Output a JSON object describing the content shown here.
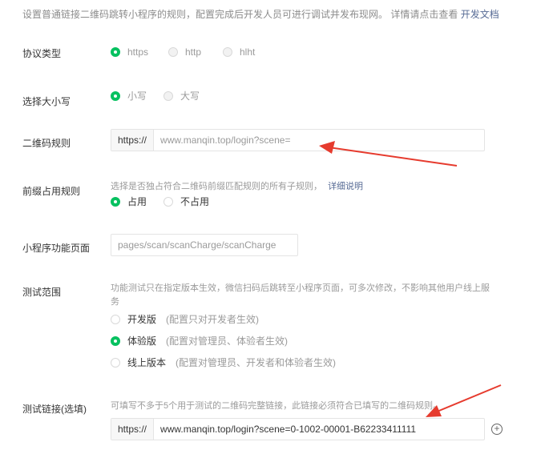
{
  "intro": {
    "text": "设置普通链接二维码跳转小程序的规则，配置完成后开发人员可进行调试并发布现网。 详情请点击查看",
    "link": "开发文档"
  },
  "protocol": {
    "label": "协议类型",
    "options": [
      "https",
      "http",
      "hlht"
    ],
    "selected": "https"
  },
  "case": {
    "label": "选择大小写",
    "options": [
      "小写",
      "大写"
    ],
    "selected": "小写"
  },
  "qr_rule": {
    "label": "二维码规则",
    "prefix": "https://",
    "value": "www.manqin.top/login?scene="
  },
  "prefix_rule": {
    "label": "前缀占用规则",
    "hint": "选择是否独占符合二维码前缀匹配规则的所有子规则，",
    "hint_link": "详细说明",
    "options": [
      "占用",
      "不占用"
    ],
    "selected": "占用"
  },
  "mini_page": {
    "label": "小程序功能页面",
    "value": "pages/scan/scanCharge/scanCharge"
  },
  "test_scope": {
    "label": "测试范围",
    "desc": "功能测试只在指定版本生效，微信扫码后跳转至小程序页面，可多次修改，不影响其他用户线上服务",
    "options": [
      {
        "name": "开发版",
        "note": "(配置只对开发者生效)"
      },
      {
        "name": "体验版",
        "note": "(配置对管理员、体验者生效)"
      },
      {
        "name": "线上版本",
        "note": "(配置对管理员、开发者和体验者生效)"
      }
    ],
    "selected": "体验版"
  },
  "test_link": {
    "label": "测试链接(选填)",
    "desc": "可填写不多于5个用于测试的二维码完整链接，此链接必须符合已填写的二维码规则。",
    "prefix": "https://",
    "value": "www.manqin.top/login?scene=0-1002-00001-B62233411111"
  },
  "colors": {
    "accent": "#07c160",
    "link": "#576b95",
    "arrow": "#e63b2e"
  }
}
